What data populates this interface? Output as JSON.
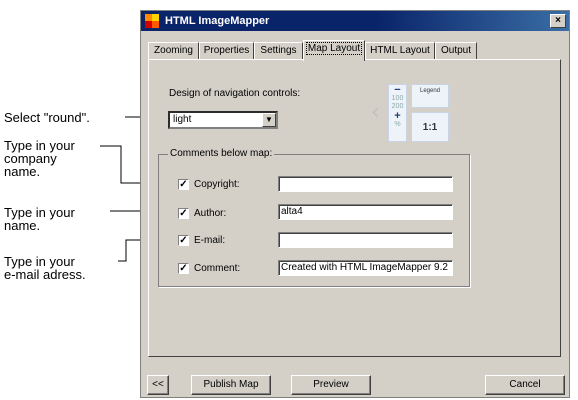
{
  "window": {
    "title": "HTML ImageMapper",
    "close_glyph": "×"
  },
  "tabs": [
    {
      "label": "Zooming"
    },
    {
      "label": "Properties"
    },
    {
      "label": "Settings"
    },
    {
      "label": "Map Layout",
      "active": true
    },
    {
      "label": "HTML Layout"
    },
    {
      "label": "Output"
    }
  ],
  "nav_design": {
    "label": "Design of navigation controls:",
    "selected": "light",
    "preview": {
      "arrow": "‹",
      "zoom_values": [
        "100",
        "200"
      ],
      "zoom_plus": "+",
      "zoom_minus": "−",
      "zoom_percent": "%",
      "legend": "Legend",
      "one_to_one": "1:1"
    }
  },
  "comments": {
    "legend": "Comments below map:",
    "rows": [
      {
        "label": "Copyright:",
        "checked": true,
        "value": ""
      },
      {
        "label": "Author:",
        "checked": true,
        "value": "alta4"
      },
      {
        "label": "E-mail:",
        "checked": true,
        "value": ""
      },
      {
        "label": "Comment:",
        "checked": true,
        "value": "Created with HTML ImageMapper 9.2"
      }
    ]
  },
  "buttons": {
    "back": "<<",
    "publish": "Publish Map",
    "preview": "Preview",
    "cancel": "Cancel"
  },
  "callouts": {
    "select_round": "Select \"round\".",
    "company": [
      "Type in your",
      "company",
      "name."
    ],
    "name": [
      "Type in your",
      "name."
    ],
    "email": [
      "Type in your",
      "e-mail adress."
    ]
  },
  "colors": {
    "title_bar": "#0a246a",
    "face": "#d4d0c8"
  }
}
